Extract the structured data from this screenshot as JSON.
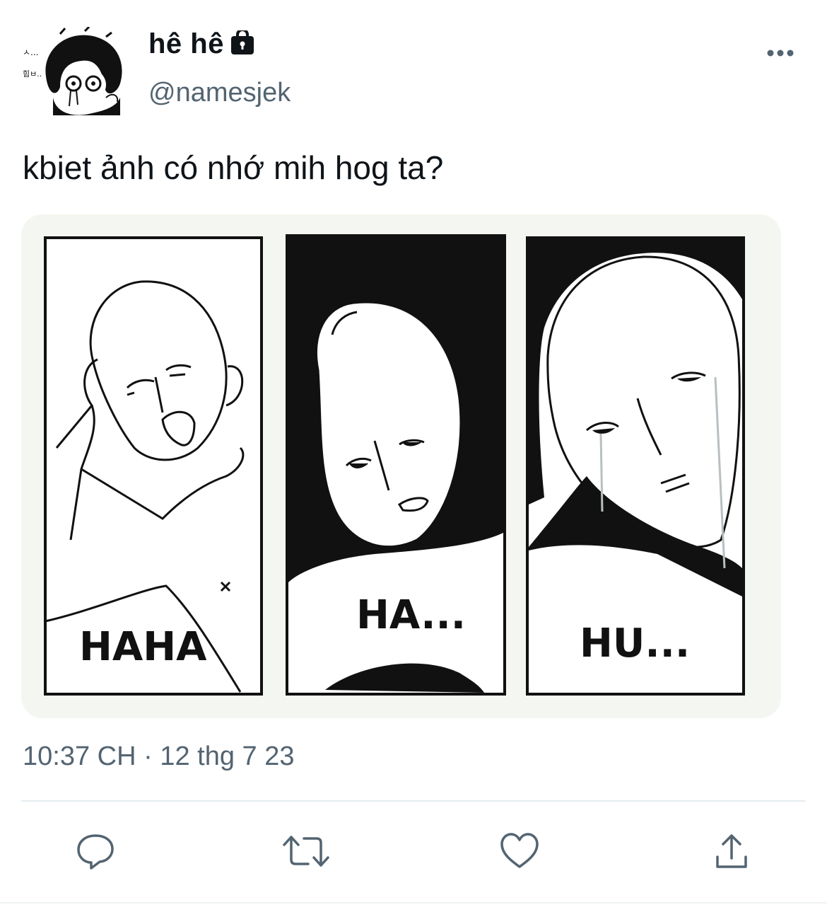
{
  "tweet": {
    "display_name": "hê hê",
    "handle": "@namesjek",
    "text": "kbiet ảnh có nhớ mih hog ta?",
    "timestamp": "10:37 CH · 12 thg 7 23",
    "media": {
      "panels": [
        {
          "caption": "HAHA"
        },
        {
          "caption": "HA..."
        },
        {
          "caption": "HU..."
        }
      ]
    }
  },
  "icons": {
    "lock": "lock-icon",
    "more": "more-horizontal-icon",
    "reply": "reply-icon",
    "retweet": "retweet-icon",
    "like": "heart-icon",
    "share": "share-icon"
  },
  "colors": {
    "text_primary": "#0f1419",
    "text_secondary": "#536471",
    "icon_gray": "#536471",
    "divider": "#e6ecf0"
  }
}
